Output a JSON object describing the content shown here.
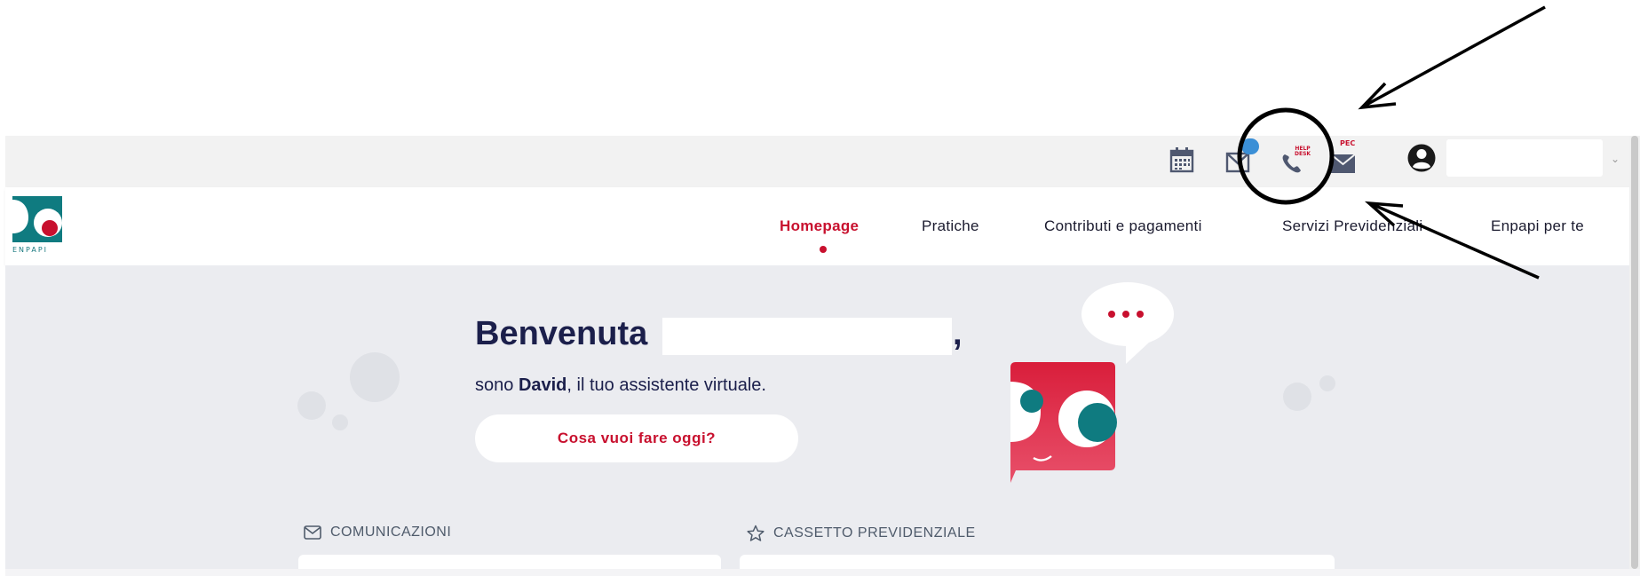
{
  "topbar": {
    "help_desk_label_line1": "HELP",
    "help_desk_label_line2": "DESK",
    "pec_label": "PEC",
    "icons": [
      "calendar-icon",
      "mail-notification-icon",
      "phone-help-desk-icon",
      "pec-mail-icon",
      "user-avatar-icon",
      "chevron-down-icon"
    ]
  },
  "logo": {
    "text": "ENPAPI"
  },
  "nav": {
    "items": [
      {
        "label": "Homepage"
      },
      {
        "label": "Pratiche"
      },
      {
        "label": "Contributi e pagamenti"
      },
      {
        "label": "Servizi Previdenziali"
      },
      {
        "label": "Enpapi per te"
      }
    ]
  },
  "hero": {
    "welcome": "Benvenuta",
    "comma": ",",
    "assistant_prefix": "sono ",
    "assistant_name": "David",
    "assistant_suffix": ", il tuo assistente virtuale.",
    "cta_label": "Cosa vuoi fare oggi?"
  },
  "sections": {
    "comunicazioni": "COMUNICAZIONI",
    "cassetto": "CASSETTO PREVIDENZIALE"
  },
  "colors": {
    "accent": "#c8102e",
    "teal": "#0f7b80",
    "navy": "#1b1f4b",
    "badge": "#3b8fd6"
  }
}
